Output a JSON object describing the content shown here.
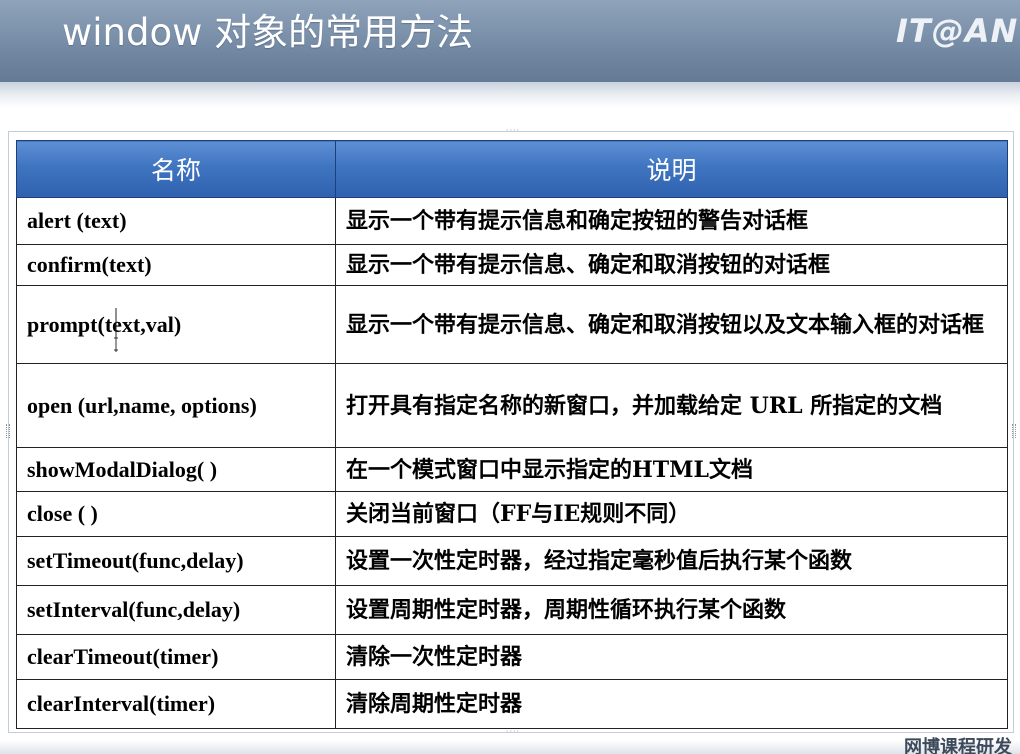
{
  "slide": {
    "title": "window 对象的常用方法",
    "logo_text": "IT@AN",
    "footer_text": "网博课程研发"
  },
  "table": {
    "headers": [
      "名称",
      "说明"
    ],
    "rows": [
      {
        "name": "alert (text)",
        "desc": "显示一个带有提示信息和确定按钮的警告对话框"
      },
      {
        "name": "confirm(text)",
        "desc": "显示一个带有提示信息、确定和取消按钮的对话框"
      },
      {
        "name": "prompt(text,val)",
        "desc": "显示一个带有提示信息、确定和取消按钮以及文本输入框的对话框"
      },
      {
        "name": "open (url,name, options)",
        "desc": "打开具有指定名称的新窗口，并加载给定 URL 所指定的文档"
      },
      {
        "name": "showModalDialog( )",
        "desc": "在一个模式窗口中显示指定的HTML文档"
      },
      {
        "name": "close ( )",
        "desc": "关闭当前窗口（FF与IE规则不同）"
      },
      {
        "name": "setTimeout(func,delay)",
        "desc": "设置一次性定时器，经过指定毫秒值后执行某个函数"
      },
      {
        "name": "setInterval(func,delay)",
        "desc": "设置周期性定时器，周期性循环执行某个函数"
      },
      {
        "name": "clearTimeout(timer)",
        "desc": "清除一次性定时器"
      },
      {
        "name": "clearInterval(timer)",
        "desc": "清除周期性定时器"
      }
    ]
  },
  "colors": {
    "header_band": "#7f94ad",
    "table_header": "#3f74c0",
    "border": "#222222"
  }
}
